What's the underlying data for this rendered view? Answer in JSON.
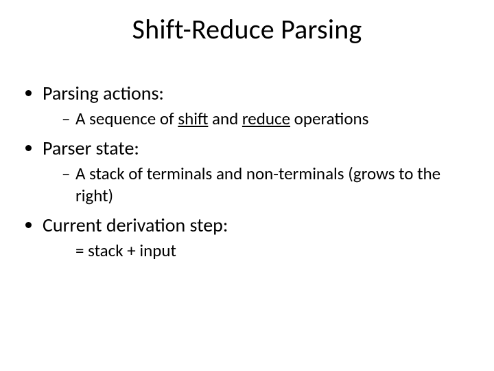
{
  "title": "Shift-Reduce Parsing",
  "bullets": {
    "b1": {
      "label": "Parsing actions:",
      "sub_pre": "A sequence of ",
      "sub_u1": "shift",
      "sub_mid": " and ",
      "sub_u2": "reduce",
      "sub_post": " operations"
    },
    "b2": {
      "label": "Parser state:",
      "sub": "A stack of terminals and non-terminals (grows to the right)"
    },
    "b3": {
      "label": "Current derivation step:",
      "sub": "= stack + input"
    }
  }
}
